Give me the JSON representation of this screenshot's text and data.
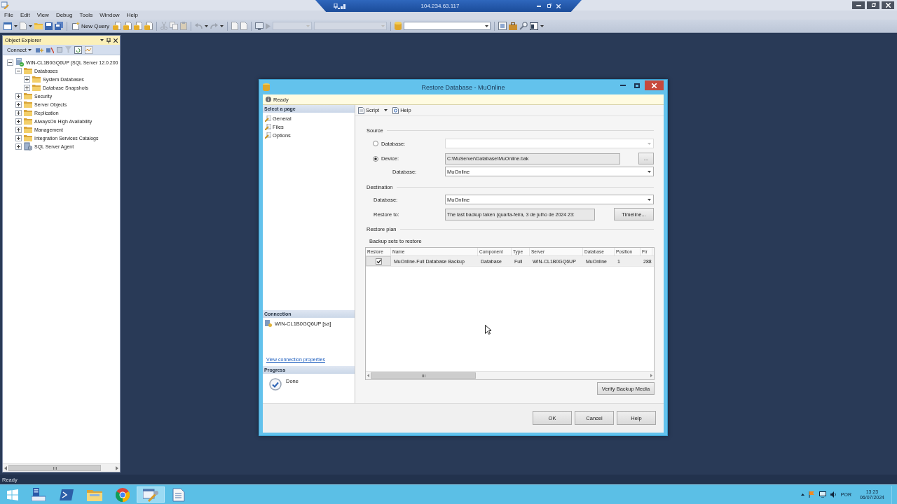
{
  "remote_bar": {
    "address": "104.234.63.117"
  },
  "menu": [
    "File",
    "Edit",
    "View",
    "Debug",
    "Tools",
    "Window",
    "Help"
  ],
  "toolbar": {
    "new_query": "New Query"
  },
  "object_explorer": {
    "title": "Object Explorer",
    "connect": "Connect",
    "tree": [
      {
        "label": "WIN-CL1B0GQ6UP (SQL Server 12.0.200",
        "kind": "server",
        "expanded": true,
        "children": [
          {
            "label": "Databases",
            "kind": "folder",
            "expanded": true,
            "children": [
              {
                "label": "System Databases",
                "kind": "folder",
                "expanded": false
              },
              {
                "label": "Database Snapshots",
                "kind": "folder",
                "expanded": false
              }
            ]
          },
          {
            "label": "Security",
            "kind": "folder",
            "expanded": false
          },
          {
            "label": "Server Objects",
            "kind": "folder",
            "expanded": false
          },
          {
            "label": "Replication",
            "kind": "folder",
            "expanded": false
          },
          {
            "label": "AlwaysOn High Availability",
            "kind": "folder",
            "expanded": false
          },
          {
            "label": "Management",
            "kind": "folder",
            "expanded": false
          },
          {
            "label": "Integration Services Catalogs",
            "kind": "folder",
            "expanded": false
          },
          {
            "label": "SQL Server Agent",
            "kind": "agent",
            "expanded": false
          }
        ]
      }
    ]
  },
  "status_bar": {
    "text": "Ready"
  },
  "dialog": {
    "title": "Restore Database - MuOnline",
    "status": "Ready",
    "select_page": {
      "header": "Select a page",
      "pages": [
        "General",
        "Files",
        "Options"
      ]
    },
    "connection": {
      "header": "Connection",
      "server": "WIN-CL1B0GQ6UP [sa]",
      "link": "View connection properties"
    },
    "progress": {
      "header": "Progress",
      "status": "Done"
    },
    "toolbar": {
      "script": "Script",
      "help": "Help"
    },
    "source": {
      "label": "Source",
      "options": [
        {
          "kind": "dropdown",
          "label": "Database:",
          "selected": false
        },
        {
          "kind": "file",
          "label": "Device:",
          "selected": true,
          "value": "C:\\MuServer\\Database\\MuOnline.bak",
          "browse": "..."
        }
      ],
      "database": {
        "label": "Database:",
        "value": "MuOnline"
      }
    },
    "destination": {
      "label": "Destination",
      "database": {
        "label": "Database:",
        "value": "MuOnline"
      },
      "restore_to": {
        "label": "Restore to:",
        "value": "The last backup taken (quarta-feira, 3 de julho de 2024 23:"
      },
      "timeline": "Timeline..."
    },
    "restore_plan": {
      "label": "Restore plan",
      "backup_sets_label": "Backup sets to restore",
      "columns": [
        "Restore",
        "Name",
        "Component",
        "Type",
        "Server",
        "Database",
        "Position",
        "Fir"
      ],
      "rows": [
        {
          "cells": [
            {
              "kind": "checkbox",
              "checked": true
            },
            "MuOnline-Full Database Backup",
            "Database",
            "Full",
            "WIN-CL1B0GQ6UP",
            "MuOnline",
            "1",
            "288"
          ]
        }
      ],
      "verify": "Verify Backup Media"
    },
    "buttons": [
      "OK",
      "Cancel",
      "Help"
    ]
  },
  "taskbar": {
    "apps": [
      {
        "kind": "server_manager",
        "active": false
      },
      {
        "kind": "terminal",
        "active": false
      },
      {
        "kind": "explorer",
        "active": false
      },
      {
        "kind": "browser",
        "active": false
      },
      {
        "kind": "ssms",
        "active": true
      },
      {
        "kind": "notepad",
        "active": false
      }
    ],
    "tray": {
      "language": "POR",
      "time": "13:23",
      "date": "06/07/2024"
    }
  }
}
